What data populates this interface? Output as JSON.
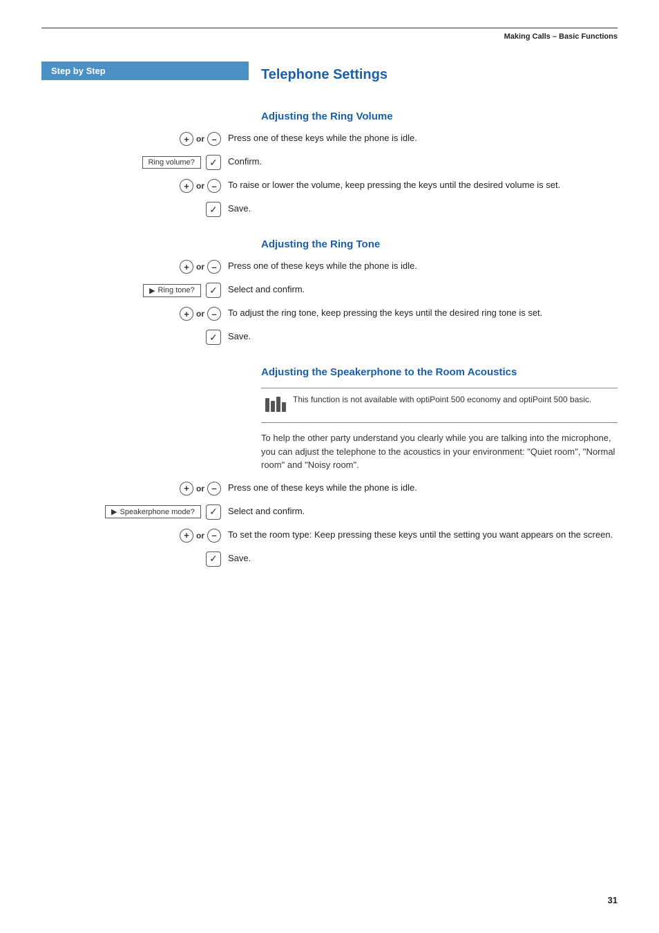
{
  "page": {
    "header": "Making Calls – Basic Functions",
    "page_number": "31"
  },
  "step_by_step_label": "Step by Step",
  "section_title": "Telephone Settings",
  "subsections": [
    {
      "id": "ring-volume",
      "title": "Adjusting the Ring Volume",
      "steps": [
        {
          "left_type": "keys_or",
          "key_plus": "+",
          "key_minus": "–",
          "text": "Press one of these keys while the phone is idle."
        },
        {
          "left_type": "menu",
          "menu_label": "Ring volume?",
          "has_arrow": false,
          "right_type": "check",
          "text": "Confirm."
        },
        {
          "left_type": "keys_or",
          "key_plus": "+",
          "key_minus": "–",
          "text": "To raise or lower the volume, keep pressing the keys until the desired volume is set."
        },
        {
          "left_type": "check",
          "text": "Save."
        }
      ]
    },
    {
      "id": "ring-tone",
      "title": "Adjusting the Ring Tone",
      "steps": [
        {
          "left_type": "keys_or",
          "key_plus": "+",
          "key_minus": "–",
          "text": "Press one of these keys while the phone is idle."
        },
        {
          "left_type": "menu",
          "menu_label": "Ring tone?",
          "has_arrow": true,
          "right_type": "check",
          "text": "Select and confirm."
        },
        {
          "left_type": "keys_or",
          "key_plus": "+",
          "key_minus": "–",
          "text": "To adjust the ring tone, keep pressing the keys until the desired ring tone is set."
        },
        {
          "left_type": "check",
          "text": "Save."
        }
      ]
    },
    {
      "id": "speakerphone",
      "title": "Adjusting the Speakerphone to the Room Acoustics",
      "note_text": "This function is not available with optiPoint 500 economy and optiPoint 500 basic.",
      "description": "To help the other party understand you clearly while you are talking into the microphone, you can adjust the telephone to the acoustics in your environment: \"Quiet room\", \"Normal room\" and \"Noisy room\".",
      "steps": [
        {
          "left_type": "keys_or",
          "key_plus": "+",
          "key_minus": "–",
          "text": "Press one of these keys while the phone is idle."
        },
        {
          "left_type": "menu",
          "menu_label": "Speakerphone mode?",
          "has_arrow": true,
          "right_type": "check",
          "text": "Select and confirm."
        },
        {
          "left_type": "keys_or",
          "key_plus": "+",
          "key_minus": "–",
          "text": "To set the room type: Keep pressing these keys until the setting you want appears on the screen."
        },
        {
          "left_type": "check",
          "text": "Save."
        }
      ]
    }
  ]
}
